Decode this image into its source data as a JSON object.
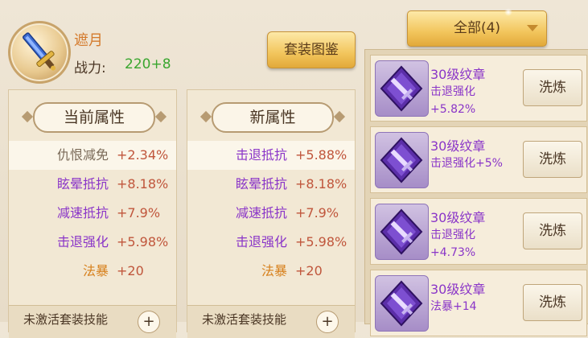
{
  "item": {
    "name": "遮月",
    "power_label": "战力:",
    "power_value": "220+8"
  },
  "set_button": "套装图鉴",
  "filter": {
    "label": "全部(4)"
  },
  "current_panel": {
    "title": "当前属性",
    "rows": [
      {
        "name": "仇恨减免",
        "value": "+2.34%",
        "color": "#7a6a58"
      },
      {
        "name": "眩晕抵抗",
        "value": "+8.18%",
        "color": "#8a35c8"
      },
      {
        "name": "减速抵抗",
        "value": "+7.9%",
        "color": "#8a35c8"
      },
      {
        "name": "击退强化",
        "value": "+5.98%",
        "color": "#8a35c8"
      },
      {
        "name": "法暴",
        "value": "+20",
        "color": "#d7801c"
      }
    ],
    "bottom_label": "未激活套装技能"
  },
  "new_panel": {
    "title": "新属性",
    "rows": [
      {
        "name": "击退抵抗",
        "value": "+5.88%",
        "color": "#8a35c8"
      },
      {
        "name": "眩晕抵抗",
        "value": "+8.18%",
        "color": "#8a35c8"
      },
      {
        "name": "减速抵抗",
        "value": "+7.9%",
        "color": "#8a35c8"
      },
      {
        "name": "击退强化",
        "value": "+5.98%",
        "color": "#8a35c8"
      },
      {
        "name": "法暴",
        "value": "+20",
        "color": "#d7801c"
      }
    ],
    "bottom_label": "未激活套装技能"
  },
  "emblems": [
    {
      "title": "30级纹章",
      "effect": "击退强化+5.82%",
      "action": "洗炼"
    },
    {
      "title": "30级纹章",
      "effect": "击退强化+5%",
      "action": "洗炼"
    },
    {
      "title": "30级纹章",
      "effect": "击退强化+4.73%",
      "action": "洗炼"
    },
    {
      "title": "30级纹章",
      "effect": "法暴+14",
      "action": "洗炼"
    }
  ],
  "colors": {
    "accent_gold": "#f2c55c",
    "purple": "#8a35c8",
    "orange": "#d7801c",
    "green": "#3aa62f"
  }
}
